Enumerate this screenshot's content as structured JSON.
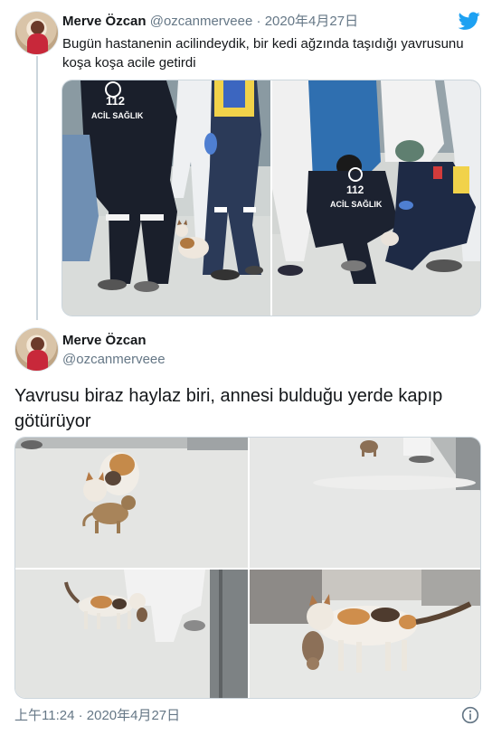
{
  "tweet1": {
    "author_name": "Merve Özcan",
    "handle": "@ozcanmerveee",
    "separator": "·",
    "date": "2020年4月27日",
    "text": "Bugün hastanenin acilindeydik, bir kedi ağzında taşıdığı yavrusunu koşa koşa acile getirdi",
    "photo_texts": {
      "badge_number": "112",
      "badge_text_left": "ACİL SAĞLIK",
      "badge_text_right": "ACİL SAĞLIK"
    }
  },
  "tweet2": {
    "author_name": "Merve Özcan",
    "handle": "@ozcanmerveee",
    "text": "Yavrusu biraz haylaz biri, annesi bulduğu yerde kapıp götürüyor",
    "timestamp": "上午11:24 · 2020年4月27日"
  },
  "icons": {
    "brand": "twitter-bird-icon",
    "info": "info-icon"
  },
  "colors": {
    "brand": "#1da1f2",
    "secondary_text": "#657786",
    "primary_text": "#14171a",
    "border": "#ccd6dd"
  }
}
